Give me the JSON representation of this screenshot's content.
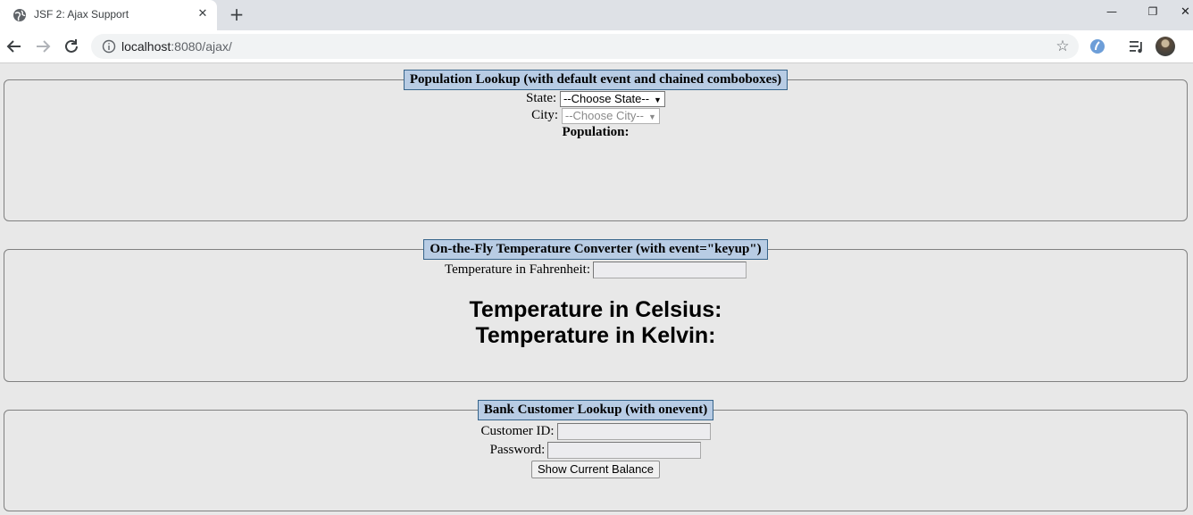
{
  "browser": {
    "tab_title": "JSF 2: Ajax Support",
    "tab_close": "✕",
    "new_tab": "+",
    "url_host": "localhost",
    "url_path": ":8080/ajax/",
    "window_minimize": "—",
    "window_restore": "❐",
    "window_close": "✕"
  },
  "population": {
    "legend": "Population Lookup (with default event and chained comboboxes)",
    "state_label": "State:",
    "state_selected": "--Choose State--",
    "city_label": "City:",
    "city_selected": "--Choose City--",
    "population_label": "Population:"
  },
  "temperature": {
    "legend": "On-the-Fly Temperature Converter (with event=\"keyup\")",
    "fahrenheit_label": "Temperature in Fahrenheit:",
    "celsius_label": "Temperature in Celsius:",
    "kelvin_label": "Temperature in Kelvin:"
  },
  "bank": {
    "legend": "Bank Customer Lookup (with onevent)",
    "customer_id_label": "Customer ID:",
    "password_label": "Password:",
    "button_label": "Show Current Balance"
  }
}
